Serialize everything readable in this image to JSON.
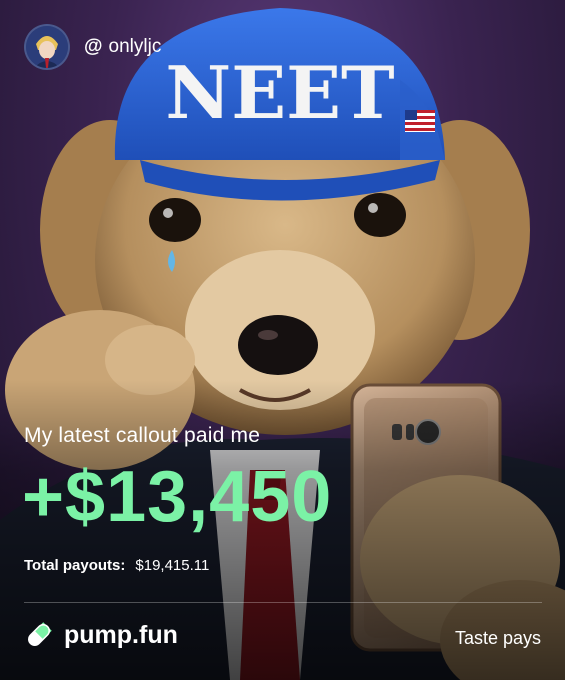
{
  "header": {
    "handle_at": "@",
    "handle": "onlyljc"
  },
  "hat": {
    "text": "NEET"
  },
  "callout": {
    "caption": "My latest callout paid me",
    "amount": "+$13,450"
  },
  "payouts": {
    "label": "Total payouts:",
    "value": "$19,415.11"
  },
  "footer": {
    "brand": "pump.fun",
    "tagline": "Taste pays"
  },
  "colors": {
    "accent_green": "#7bf2a6",
    "hat_blue": "#2f66d8",
    "background_purple": "#3a2350"
  },
  "icons": {
    "brand": "pill-icon",
    "avatar": "anime-avatar"
  }
}
